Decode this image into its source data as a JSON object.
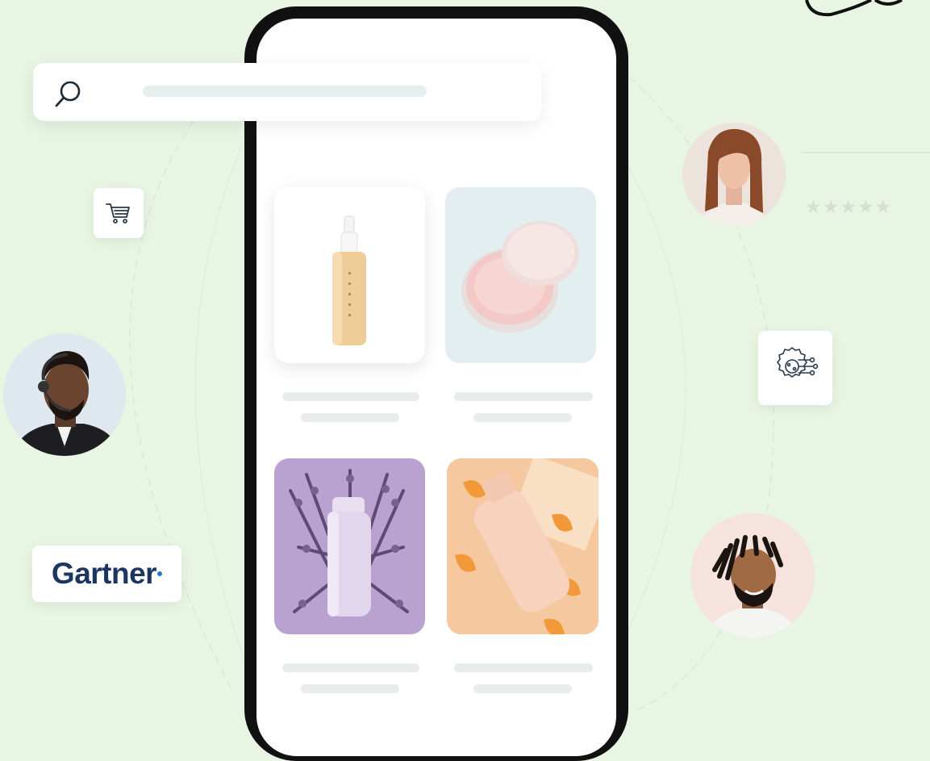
{
  "search": {
    "icon": "search-icon"
  },
  "products": [
    {
      "name": "spray-bottle",
      "bg": "#ffffff"
    },
    {
      "name": "cream-jar",
      "bg": "#e3eef0"
    },
    {
      "name": "lavender-lotion",
      "bg": "#b9a2cf"
    },
    {
      "name": "peach-lotion",
      "bg": "#f2b98e"
    }
  ],
  "badges": {
    "cart_icon": "shopping-cart-icon",
    "ai_icon": "ai-gear-circuit-icon",
    "gartner_logo": "Gartner"
  },
  "review": {
    "stars": "★★★★★"
  },
  "colors": {
    "background": "#e8f5e3",
    "phone_frame": "#111111",
    "gartner": "#1d3660"
  }
}
